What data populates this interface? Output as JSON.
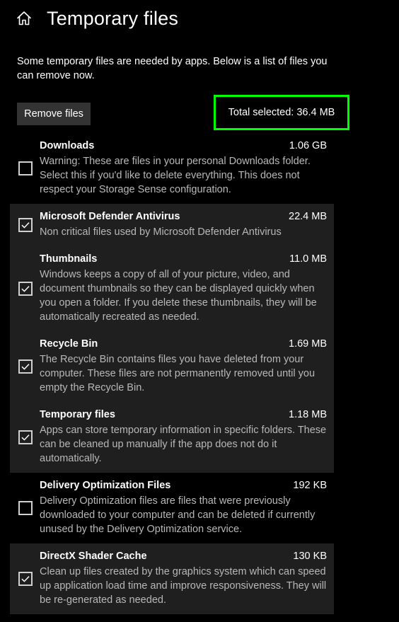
{
  "header": {
    "title": "Temporary files",
    "home_icon": "home-icon"
  },
  "intro": {
    "text": "Some temporary files are needed by apps. Below is a list of files you can remove now."
  },
  "actions": {
    "remove_label": "Remove files",
    "total_selected": "Total selected: 36.4 MB",
    "highlight_color": "#00ff00"
  },
  "items": [
    {
      "name": "Downloads",
      "size": "1.06 GB",
      "checked": false,
      "description": "Warning: These are files in your personal Downloads folder. Select this if you'd like to delete everything. This does not respect your Storage Sense configuration."
    },
    {
      "name": "Microsoft Defender Antivirus",
      "size": "22.4 MB",
      "checked": true,
      "description": "Non critical files used by Microsoft Defender Antivirus"
    },
    {
      "name": "Thumbnails",
      "size": "11.0 MB",
      "checked": true,
      "description": "Windows keeps a copy of all of your picture, video, and document thumbnails so they can be displayed quickly when you open a folder. If you delete these thumbnails, they will be automatically recreated as needed."
    },
    {
      "name": "Recycle Bin",
      "size": "1.69 MB",
      "checked": true,
      "description": "The Recycle Bin contains files you have deleted from your computer. These files are not permanently removed until you empty the Recycle Bin."
    },
    {
      "name": "Temporary files",
      "size": "1.18 MB",
      "checked": true,
      "description": "Apps can store temporary information in specific folders. These can be cleaned up manually if the app does not do it automatically."
    },
    {
      "name": "Delivery Optimization Files",
      "size": "192 KB",
      "checked": false,
      "description": "Delivery Optimization files are files that were previously downloaded to your computer and can be deleted if currently unused by the Delivery Optimization service."
    },
    {
      "name": "DirectX Shader Cache",
      "size": "130 KB",
      "checked": true,
      "description": "Clean up files created by the graphics system which can speed up application load time and improve responsiveness. They will be re-generated as needed."
    }
  ]
}
